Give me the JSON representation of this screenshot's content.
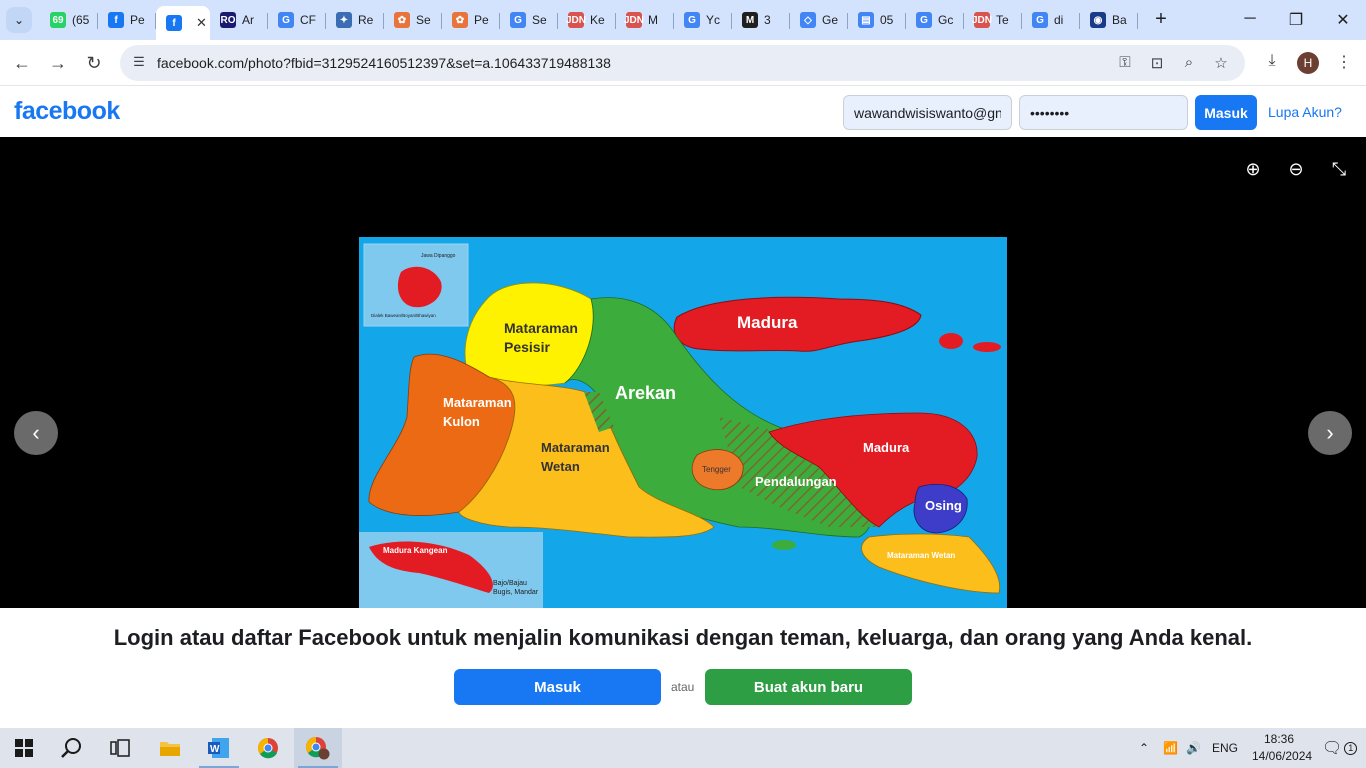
{
  "browser": {
    "tabs": [
      {
        "title": "(65",
        "favicon_color": "#25d366",
        "favicon_glyph": "69",
        "active": false
      },
      {
        "title": "Pe",
        "favicon_color": "#1877f2",
        "favicon_glyph": "f",
        "active": false
      },
      {
        "title": "",
        "favicon_color": "#1877f2",
        "favicon_glyph": "f",
        "active": true
      },
      {
        "title": "Ar",
        "favicon_color": "#1a1a6e",
        "favicon_glyph": "RO",
        "active": false
      },
      {
        "title": "CF",
        "favicon_color": "#4285f4",
        "favicon_glyph": "G",
        "active": false
      },
      {
        "title": "Re",
        "favicon_color": "#3b6db3",
        "favicon_glyph": "✦",
        "active": false
      },
      {
        "title": "Se",
        "favicon_color": "#e8743b",
        "favicon_glyph": "✿",
        "active": false
      },
      {
        "title": "Pe",
        "favicon_color": "#e8743b",
        "favicon_glyph": "✿",
        "active": false
      },
      {
        "title": "Se",
        "favicon_color": "#4285f4",
        "favicon_glyph": "G",
        "active": false
      },
      {
        "title": "Ke",
        "favicon_color": "#d9534f",
        "favicon_glyph": "JDN",
        "active": false
      },
      {
        "title": "M",
        "favicon_color": "#d9534f",
        "favicon_glyph": "JDN",
        "active": false
      },
      {
        "title": "Yc",
        "favicon_color": "#4285f4",
        "favicon_glyph": "G",
        "active": false
      },
      {
        "title": "3",
        "favicon_color": "#1f1f1f",
        "favicon_glyph": "M",
        "active": false
      },
      {
        "title": "Ge",
        "favicon_color": "#4285f4",
        "favicon_glyph": "◇",
        "active": false
      },
      {
        "title": "05",
        "favicon_color": "#4285f4",
        "favicon_glyph": "▤",
        "active": false
      },
      {
        "title": "Gc",
        "favicon_color": "#4285f4",
        "favicon_glyph": "G",
        "active": false
      },
      {
        "title": "Te",
        "favicon_color": "#d9534f",
        "favicon_glyph": "JDN",
        "active": false
      },
      {
        "title": "di",
        "favicon_color": "#4285f4",
        "favicon_glyph": "G",
        "active": false
      },
      {
        "title": "Ba",
        "favicon_color": "#1a3a8a",
        "favicon_glyph": "◉",
        "active": false
      }
    ],
    "tab_close": "✕",
    "new_tab": "+",
    "window_controls": {
      "minimize": "─",
      "restore": "❐",
      "close": "✕"
    },
    "url": "facebook.com/photo?fbid=3129524160512397&set=a.106433719488138",
    "profile_initial": "H"
  },
  "facebook": {
    "logo": "facebook",
    "email_value": "wawandwisiswanto@gn",
    "password_value": "••••••••",
    "login_button": "Masuk",
    "forgot_link": "Lupa Akun?",
    "brand_blue": "#1877f2",
    "brand_green": "#2e9e44"
  },
  "map": {
    "labels": {
      "inset_top": "Jawa Dipanggo",
      "inset_top_caption": "Dialek Bawean/Boyan/Bhawiyan",
      "mataraman_pesisir_1": "Mataraman",
      "mataraman_pesisir_2": "Pesisir",
      "arekan": "Arekan",
      "madura_north": "Madura",
      "mataraman_kulon_1": "Mataraman",
      "mataraman_kulon_2": "Kulon",
      "mataraman_wetan_1": "Mataraman",
      "mataraman_wetan_2": "Wetan",
      "tengger": "Tengger",
      "pendalungan": "Pendalungan",
      "madura_east": "Madura",
      "osing": "Osing",
      "mataraman_wetan_south": "Mataraman Wetan",
      "madura_kangean": "Madura Kangean",
      "bajo_1": "Bajo/Bajau",
      "bajo_2": "Bugis, Mandar"
    }
  },
  "prompt": {
    "title": "Login atau daftar Facebook untuk menjalin komunikasi dengan teman, keluarga, dan orang yang Anda kenal.",
    "login_button": "Masuk",
    "or_text": "atau",
    "signup_button": "Buat akun baru"
  },
  "taskbar": {
    "language": "ENG",
    "time": "18:36",
    "date": "14/06/2024",
    "notification_count": "1"
  }
}
